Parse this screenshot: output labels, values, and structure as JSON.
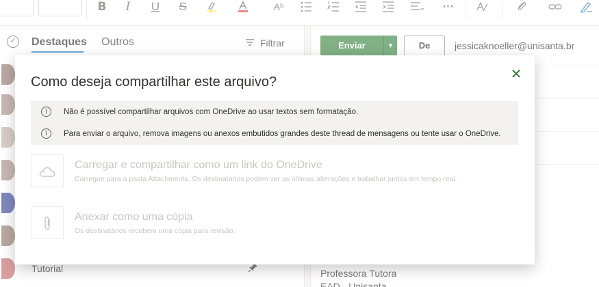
{
  "toolbar": {
    "icons": [
      "bold-icon",
      "italic-icon",
      "underline-icon",
      "strikethrough-icon",
      "highlight-icon",
      "font-color-icon",
      "format-painter-icon",
      "bullets-icon",
      "numbering-icon",
      "decrease-indent-icon",
      "increase-indent-icon",
      "align-icon",
      "more-icon",
      "styles-icon",
      "attach-icon",
      "link-icon",
      "signature-icon"
    ],
    "labels": {
      "bold": "B",
      "italic": "I",
      "underline": "U",
      "strike": "S",
      "more": "···"
    },
    "colors": {
      "highlight": "#ffe94d",
      "font_color": "#e8383d"
    }
  },
  "list": {
    "tabs": [
      {
        "label": "Destaques"
      },
      {
        "label": "Outros"
      }
    ],
    "filter_label": "Filtrar",
    "visible_row_label": "Tutorial"
  },
  "compose": {
    "send_label": "Enviar",
    "from_label": "De",
    "from_email": "jessicaknoeller@unisanta.br",
    "signature_line1": "Professora Tutora",
    "signature_line2": "EAD - Unisanta"
  },
  "dialog": {
    "title": "Como deseja compartilhar este arquivo?",
    "notices": [
      "Não é possível compartilhar arquivos com OneDrive ao usar textos sem formatação.",
      "Para enviar o arquivo, remova imagens ou anexos embutidos grandes deste thread de mensagens ou tente usar o OneDrive."
    ],
    "options": [
      {
        "icon": "cloud-icon",
        "title": "Carregar e compartilhar como um link do OneDrive",
        "description": "Carregue para a pasta Attachments. Os destinatários podem ver as últimas alterações e trabalhar juntos em tempo real."
      },
      {
        "icon": "paperclip-icon",
        "title": "Anexar como uma cópia",
        "description": "Os destinatários recebem uma cópia para revisão."
      }
    ]
  },
  "colors": {
    "accent_green": "#2e7d32",
    "notice_bg": "#f3f2f1",
    "disabled_text": "#c8c6c4"
  }
}
